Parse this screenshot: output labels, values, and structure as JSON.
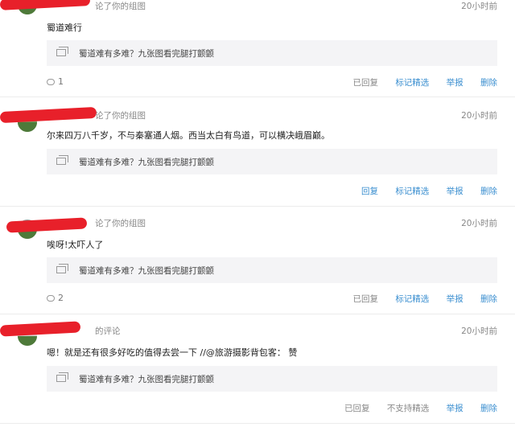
{
  "comments": [
    {
      "header_suffix": "论了你的组图",
      "time": "20小时前",
      "text": "蜀道难行",
      "quote": "蜀道难有多难？九张图看完腿打颤颤",
      "count": "1",
      "actions": [
        "已回复",
        "标记精选",
        "举报",
        "删除"
      ]
    },
    {
      "header_suffix": "论了你的组图",
      "time": "20小时前",
      "text": "尔来四万八千岁，不与秦塞通人烟。西当太白有鸟道，可以横决峨眉巅。",
      "quote": "蜀道难有多难？九张图看完腿打颤颤",
      "actions": [
        "回复",
        "标记精选",
        "举报",
        "删除"
      ]
    },
    {
      "header_suffix": "论了你的组图",
      "time": "20小时前",
      "text": "唉呀!太吓人了",
      "quote": "蜀道难有多难？九张图看完腿打颤颤",
      "count": "2",
      "actions": [
        "已回复",
        "标记精选",
        "举报",
        "删除"
      ]
    },
    {
      "header_suffix": "的评论",
      "time": "20小时前",
      "text": "嗯！就是还有很多好吃的值得去尝一下 //@旅游摄影背包客： 赞",
      "quote": "蜀道难有多难？九张图看完腿打颤颤",
      "actions": [
        "已回复",
        "不支持精选",
        "举报",
        "删除"
      ]
    }
  ]
}
